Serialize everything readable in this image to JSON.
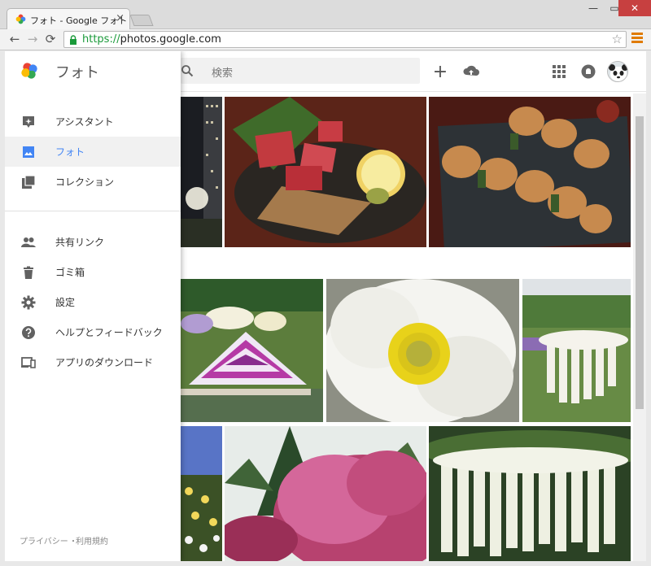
{
  "browser": {
    "tab_title": "フォト - Google フォト",
    "tab_close": "×",
    "url_scheme": "https://",
    "url_host": "photos.google.com",
    "window_controls": {
      "minimize": "—",
      "maximize": "▭",
      "close": "✕"
    }
  },
  "header": {
    "search_placeholder": "検索",
    "icons": [
      "search-icon",
      "add-icon",
      "upload-icon",
      "apps-icon",
      "notifications-icon",
      "avatar"
    ]
  },
  "drawer": {
    "title": "フォト",
    "primary_items": [
      {
        "label": "アシスタント",
        "icon": "assistant-icon",
        "active": false
      },
      {
        "label": "フォト",
        "icon": "photos-icon",
        "active": true
      },
      {
        "label": "コレクション",
        "icon": "collections-icon",
        "active": false
      }
    ],
    "secondary_items": [
      {
        "label": "共有リンク",
        "icon": "people-icon"
      },
      {
        "label": "ゴミ箱",
        "icon": "trash-icon"
      },
      {
        "label": "設定",
        "icon": "gear-icon"
      },
      {
        "label": "ヘルプとフィードバック",
        "icon": "help-icon"
      },
      {
        "label": "アプリのダウンロード",
        "icon": "devices-icon"
      }
    ],
    "footer": {
      "privacy": "プライバシー",
      "separator": "・",
      "terms": "利用規約"
    }
  },
  "colors": {
    "accent": "#4285f4",
    "https_green": "#1a9a3a",
    "chrome_menu_orange": "#e07b00",
    "close_red": "#c74040"
  },
  "photos": [
    "night-city-photo",
    "sashimi-photo",
    "yakitori-photo",
    "wisteria-garden-photo",
    "white-poppy-photo",
    "white-wisteria-photo",
    "daisy-flowers-photo",
    "pink-azalea-tree-photo",
    "wisteria-trellis-photo"
  ]
}
